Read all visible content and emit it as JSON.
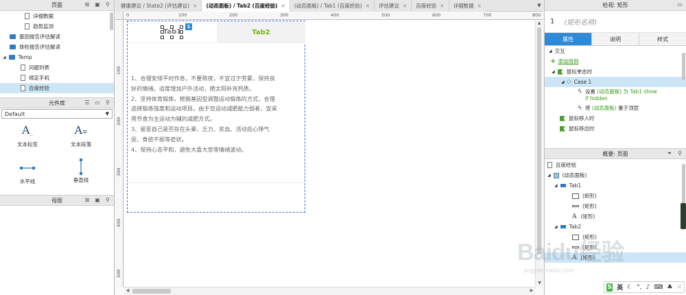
{
  "left": {
    "pages_title": "页面",
    "pages": [
      {
        "label": "详细数据",
        "type": "file",
        "indent": 36
      },
      {
        "label": "趋势监测",
        "type": "file",
        "indent": 36
      },
      {
        "label": "基因报告评估解读",
        "type": "folder",
        "indent": 14
      },
      {
        "label": "体检报告评估解读",
        "type": "folder",
        "indent": 14
      },
      {
        "label": "Temp",
        "type": "folder",
        "indent": 14
      },
      {
        "label": "问题列表",
        "type": "file",
        "indent": 30
      },
      {
        "label": "绑定手机",
        "type": "file",
        "indent": 30
      },
      {
        "label": "百度经验",
        "type": "file",
        "indent": 30,
        "selected": true
      }
    ],
    "library_title": "元件库",
    "library_select": "Default",
    "widgets": [
      {
        "label": "文本标签",
        "icon": "text-label-icon"
      },
      {
        "label": "文本段落",
        "icon": "text-paragraph-icon"
      },
      {
        "label": "水平线",
        "icon": "horizontal-line-icon"
      },
      {
        "label": "垂直线",
        "icon": "vertical-line-icon"
      }
    ],
    "masters_title": "母版"
  },
  "tabs": [
    {
      "label": "健康建议 / State2 (评估建议)",
      "active": false
    },
    {
      "label": "(动态面板) / Tab2 (百度经验)",
      "active": true
    },
    {
      "label": "(动态面板) / Tab1 (百度经验)",
      "active": false
    },
    {
      "label": "评估建议",
      "active": false
    },
    {
      "label": "百度经验",
      "active": false
    },
    {
      "label": "详细数据",
      "active": false
    }
  ],
  "ruler": {
    "h": [
      "0",
      "100",
      "200",
      "300",
      "400",
      "500",
      "600",
      "700",
      "800"
    ],
    "v": [
      "100",
      "200",
      "300",
      "400",
      "500"
    ]
  },
  "canvas": {
    "tab1_label": "Tab1",
    "tab2_label": "Tab2",
    "badge": "1",
    "content": [
      "1、合理安排平时作息，不要熬夜，不宜过于劳累，保持良",
      "好的情绪。适度增加户外活动，晒太阳补充钙质。",
      "2、坚持体育锻炼，根据基因型调整运动锻炼的方式，合理",
      "选择锻炼强度和运动项目。由于您运动减肥能力弱者，宜采",
      "用节食为主运动为辅的减肥方式。",
      "3、留意自己是否存在头晕、乏力、贫血、活动后心悸气",
      "促、食欲不振等症状。",
      "4、保持心态平和，避免大喜大悲等情绪波动。"
    ]
  },
  "inspector": {
    "title": "检视: 矩形",
    "index": "1",
    "name_placeholder": "(矩形名称)",
    "tabs": [
      "属性",
      "说明",
      "样式"
    ],
    "section": "交互",
    "add_case": "添加用例",
    "events": {
      "click": "鼠标单击时",
      "case": "Case 1",
      "action1_prefix": "设置",
      "action1_green": "(动态面板)",
      "action1_rest": "为 Tab1 show if hidden",
      "action2_prefix": "将",
      "action2_green": "(动态面板)",
      "action2_rest": "置于顶层",
      "mouse_in": "鼠标移入时",
      "mouse_out": "鼠标移出时"
    }
  },
  "outline": {
    "title": "概要: 页面",
    "root": "百度经验",
    "panel": "(动态面板)",
    "tab1": "Tab1",
    "tab1_children": [
      "(矩形)",
      "(矩形)",
      "(矩形)"
    ],
    "tab2": "Tab2",
    "tab2_children": [
      "(矩形)",
      "(矩形)",
      "(矩形)"
    ]
  },
  "watermark": {
    "brand": "Baidu经验",
    "url": "jingyan.baidu.com"
  },
  "ime": {
    "label": "英"
  },
  "colors": {
    "accent": "#2e8ad6",
    "green": "#3a9a1a",
    "selection": "#cde6f7",
    "tab2_text": "#7ab317"
  }
}
